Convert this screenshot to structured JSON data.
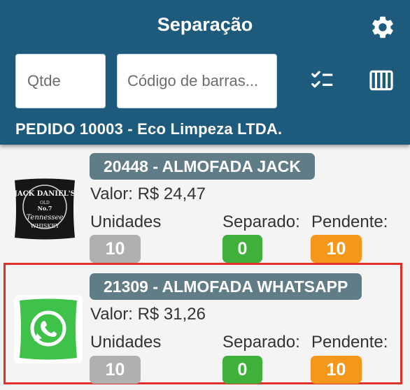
{
  "header": {
    "title": "Separação",
    "qty_placeholder": "Qtde",
    "barcode_placeholder": "Código de barras...",
    "order_label": "PEDIDO 10003 - Eco Limpeza LTDA.",
    "icons": [
      "gear-icon",
      "checklist-icon",
      "barcode-icon"
    ],
    "color": "#1d5a7c"
  },
  "labels": {
    "units": "Unidades",
    "separated": "Separado:",
    "pending": "Pendente:"
  },
  "products": [
    {
      "name": "20448 - ALMOFADA JACK",
      "price": "Valor: R$ 24,47",
      "units": "10",
      "separated": "0",
      "pending": "10",
      "thumb_text": [
        "JACK DANIEL'S",
        "OLD",
        "No.7",
        "Tennessee",
        "WHISKEY"
      ],
      "selected": false
    },
    {
      "name": "21309 - ALMOFADA WHATSAPP",
      "price": "Valor: R$ 31,26",
      "units": "10",
      "separated": "0",
      "pending": "10",
      "selected": true
    }
  ],
  "colors": {
    "badge": "#607d87",
    "units": "#b0b0b0",
    "separated": "#3fb03a",
    "pending": "#f4971a",
    "selection": "#e0302a"
  }
}
